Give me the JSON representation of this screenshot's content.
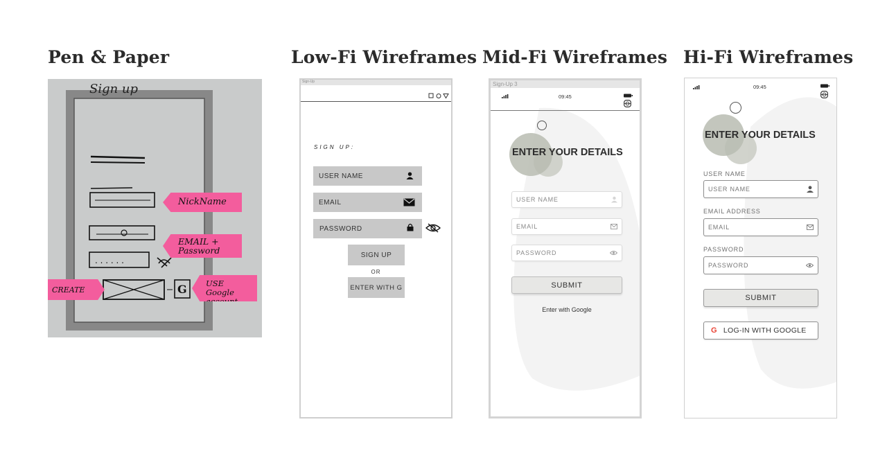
{
  "columns": {
    "pen": "Pen & Paper",
    "lofi": "Low-Fi Wireframes",
    "midfi": "Mid-Fi Wireframes",
    "hifi": "Hi-Fi Wireframes"
  },
  "sketch": {
    "title": "Sign up",
    "notes": {
      "nickname": "NickName",
      "email": "EMAIL + Password",
      "create": "CREATE",
      "google": "USE Google account"
    },
    "google_letter": "G"
  },
  "lofi": {
    "caption": "Sign-Up",
    "title": "SIGN UP:",
    "username": "USER NAME",
    "email": "EMAIL",
    "password": "PASSWORD",
    "signup_btn": "SIGN UP",
    "or": "OR",
    "enter_with": "ENTER WITH G"
  },
  "midfi": {
    "caption": "Sign-Up 3",
    "time": "09:45",
    "heading": "ENTER YOUR DETAILS",
    "username_ph": "USER NAME",
    "email_ph": "EMAIL",
    "password_ph": "PASSWORD",
    "submit": "SUBMIT",
    "google": "Enter with Google"
  },
  "hifi": {
    "time": "09:45",
    "heading": "ENTER YOUR DETAILS",
    "username_label": "USER NAME",
    "username_ph": "USER NAME",
    "email_label": "EMAIL ADDRESS",
    "email_ph": "EMAIL",
    "password_label": "PASSWORD",
    "password_ph": "PASSWORD",
    "submit": "SUBMIT",
    "google_letter": "G",
    "google": "LOG-IN WITH GOOGLE"
  },
  "icons": {
    "signal": "signal-icon",
    "battery": "battery-icon",
    "globe": "globe-icon",
    "user": "user-icon",
    "mail": "mail-icon",
    "lock": "lock-icon",
    "eye": "eye-icon",
    "eye_off": "eye-off-icon"
  },
  "colors": {
    "sticky": "#f35d9d",
    "paper": "#c9cbcb",
    "wire_gray": "#c8c8c8",
    "blob": "#c2c5bb",
    "google_red": "#ea4335"
  }
}
